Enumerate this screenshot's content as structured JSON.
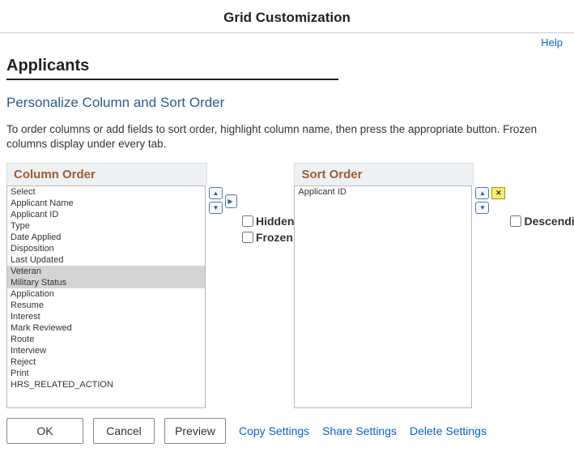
{
  "title": "Grid Customization",
  "help_label": "Help",
  "page_heading": "Applicants",
  "sub_heading": "Personalize Column and Sort Order",
  "instructions": "To order columns or add fields to sort order, highlight column name, then press the appropriate button. Frozen columns display under every tab.",
  "column_order": {
    "label": "Column Order",
    "items": [
      "Select",
      "Applicant Name",
      "Applicant ID",
      "Type",
      "Date Applied",
      "Disposition",
      "Last Updated",
      "Veteran",
      "Military Status",
      "Application",
      "Resume",
      "Interest",
      "Mark Reviewed",
      "Route",
      "Interview",
      "Reject",
      "Print",
      "HRS_RELATED_ACTION"
    ],
    "selected": [
      "Veteran",
      "Military Status"
    ],
    "hidden_label": "Hidden",
    "frozen_label": "Frozen",
    "hidden_checked": false,
    "frozen_checked": false
  },
  "sort_order": {
    "label": "Sort Order",
    "items": [
      "Applicant ID"
    ],
    "descending_label": "Descending",
    "descending_checked": false
  },
  "buttons": {
    "ok": "OK",
    "cancel": "Cancel",
    "preview": "Preview"
  },
  "links": {
    "copy": "Copy Settings",
    "share": "Share Settings",
    "delete": "Delete Settings"
  }
}
